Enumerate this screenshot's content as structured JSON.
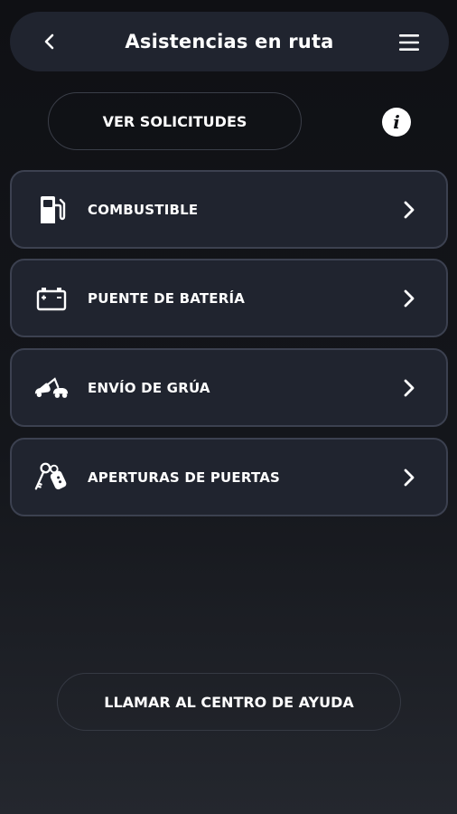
{
  "header": {
    "title": "Asistencias en ruta",
    "back_icon": "chevron-left-icon",
    "menu_icon": "hamburger-menu-icon"
  },
  "requests_button": {
    "label": "VER SOLICITUDES"
  },
  "info_button": {
    "icon": "info-icon",
    "glyph": "i"
  },
  "services": [
    {
      "label": "COMBUSTIBLE",
      "icon": "fuel-pump-icon"
    },
    {
      "label": "PUENTE DE BATERÍA",
      "icon": "battery-icon"
    },
    {
      "label": "ENVÍO DE GRÚA",
      "icon": "tow-truck-icon"
    },
    {
      "label": "APERTURAS DE PUERTAS",
      "icon": "car-keys-icon"
    }
  ],
  "help_button": {
    "label": "LLAMAR AL CENTRO DE AYUDA"
  },
  "colors": {
    "background_top": "#0f1014",
    "background_bottom": "#24272e",
    "card": "#20242f",
    "card_border": "#3c4150",
    "text": "#ffffff"
  }
}
